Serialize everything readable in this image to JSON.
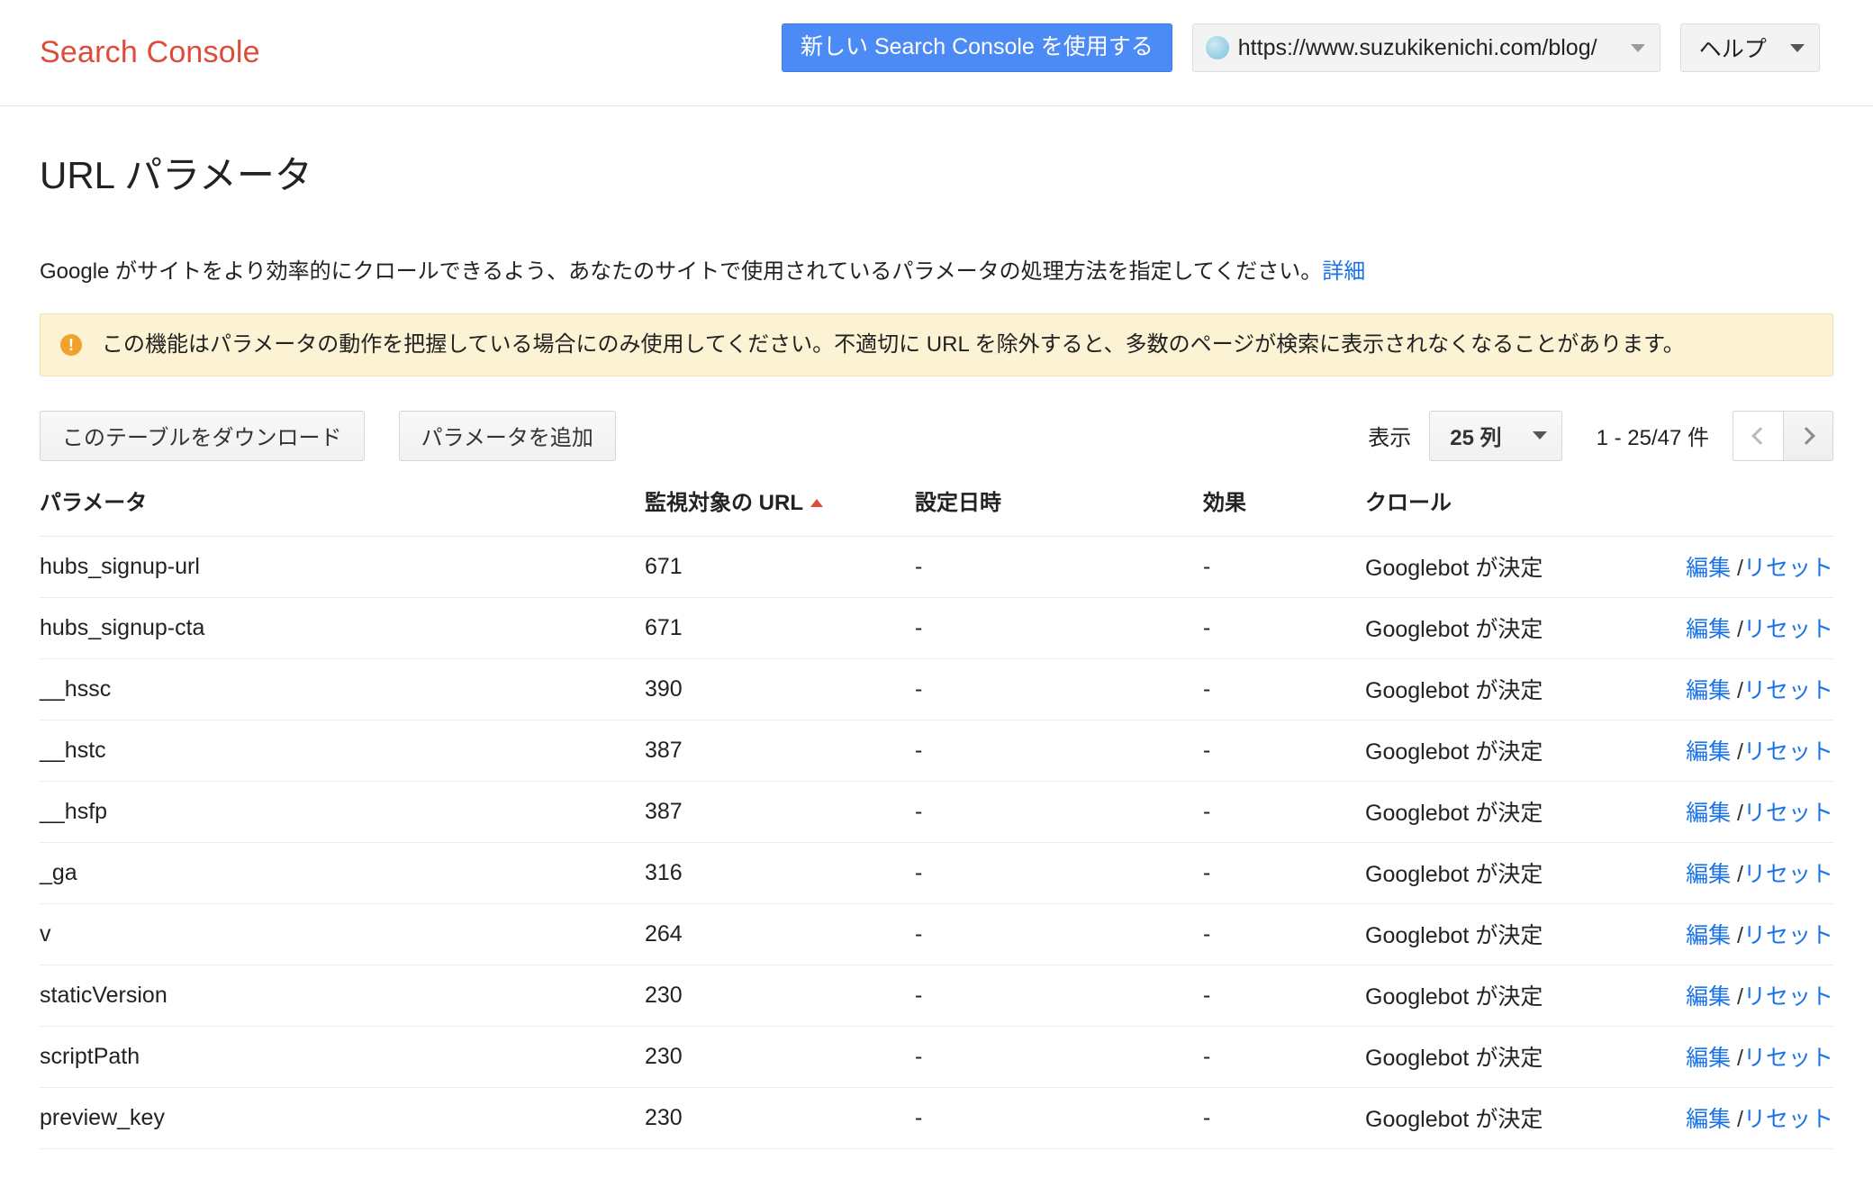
{
  "header": {
    "brand": "Search Console",
    "new_console_button": "新しい Search Console を使用する",
    "site_url": "https://www.suzukikenichi.com/blog/",
    "help_label": "ヘルプ"
  },
  "page": {
    "title": "URL パラメータ",
    "intro_text": "Google がサイトをより効率的にクロールできるよう、あなたのサイトで使用されているパラメータの処理方法を指定してください。",
    "intro_link": "詳細",
    "warning": "この機能はパラメータの動作を把握している場合にのみ使用してください。不適切に URL を除外すると、多数のページが検索に表示されなくなることがあります。"
  },
  "toolbar": {
    "download_button": "このテーブルをダウンロード",
    "add_param_button": "パラメータを追加",
    "show_label": "表示",
    "rows_value": "25 列",
    "range_label": "1 - 25/47 件",
    "prev_icon": "chevron-left-icon",
    "next_icon": "chevron-right-icon"
  },
  "table": {
    "columns": [
      {
        "label": "パラメータ",
        "sorted": false
      },
      {
        "label": "監視対象の URL",
        "sorted": true
      },
      {
        "label": "設定日時",
        "sorted": false
      },
      {
        "label": "効果",
        "sorted": false
      },
      {
        "label": "クロール",
        "sorted": false
      },
      {
        "label": "",
        "sorted": false
      }
    ],
    "edit_label": "編集",
    "separator": " /",
    "reset_label": "リセット",
    "rows": [
      {
        "parameter": "hubs_signup-url",
        "urls": "671",
        "date": "-",
        "effect": "-",
        "crawl": "Googlebot が決定"
      },
      {
        "parameter": "hubs_signup-cta",
        "urls": "671",
        "date": "-",
        "effect": "-",
        "crawl": "Googlebot が決定"
      },
      {
        "parameter": "__hssc",
        "urls": "390",
        "date": "-",
        "effect": "-",
        "crawl": "Googlebot が決定"
      },
      {
        "parameter": "__hstc",
        "urls": "387",
        "date": "-",
        "effect": "-",
        "crawl": "Googlebot が決定"
      },
      {
        "parameter": "__hsfp",
        "urls": "387",
        "date": "-",
        "effect": "-",
        "crawl": "Googlebot が決定"
      },
      {
        "parameter": "_ga",
        "urls": "316",
        "date": "-",
        "effect": "-",
        "crawl": "Googlebot が決定"
      },
      {
        "parameter": "v",
        "urls": "264",
        "date": "-",
        "effect": "-",
        "crawl": "Googlebot が決定"
      },
      {
        "parameter": "staticVersion",
        "urls": "230",
        "date": "-",
        "effect": "-",
        "crawl": "Googlebot が決定"
      },
      {
        "parameter": "scriptPath",
        "urls": "230",
        "date": "-",
        "effect": "-",
        "crawl": "Googlebot が決定"
      },
      {
        "parameter": "preview_key",
        "urls": "230",
        "date": "-",
        "effect": "-",
        "crawl": "Googlebot が決定"
      }
    ]
  },
  "colors": {
    "brand_red": "#dd4b39",
    "link_blue": "#1a73e8",
    "button_blue": "#4c8bf5",
    "warning_bg": "#fcf3d4",
    "warning_icon": "#f0a22e"
  }
}
